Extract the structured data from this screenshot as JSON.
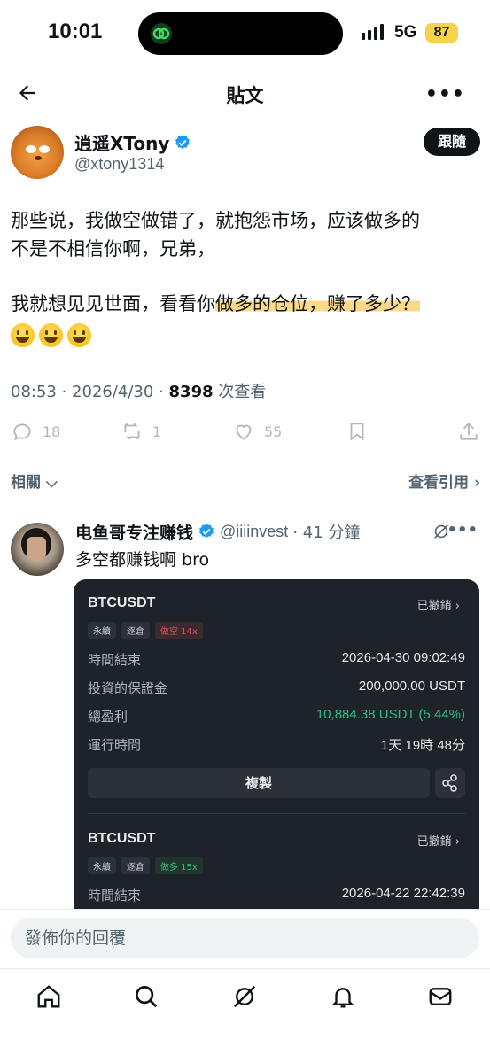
{
  "status_bar": {
    "time": "10:01",
    "network": "5G",
    "battery": "87"
  },
  "header": {
    "title": "貼文",
    "more": "•••"
  },
  "author": {
    "name": "逍遥XTony",
    "handle": "@xtony1314",
    "follow_label": "跟隨"
  },
  "tweet": {
    "line1": "那些说，我做空做错了，就抱怨市场，应该做多的",
    "line2": "不是不相信你啊，兄弟，",
    "line3_plain": "我就想见见世面，看看你",
    "line3_highlight": "做多的仓位，赚了多少？"
  },
  "meta": {
    "time": "08:53",
    "date": "2026/4/30",
    "views": "8398",
    "views_label": "次查看"
  },
  "actions": {
    "replies": "18",
    "reposts": "1",
    "likes": "55"
  },
  "related": {
    "left": "相關",
    "right": "查看引用"
  },
  "quote": {
    "name": "电鱼哥专注赚钱",
    "handle": "@iiiinvest",
    "time": "· 41 分鐘",
    "text": "多空都赚钱啊 bro"
  },
  "card": {
    "position1": {
      "symbol": "BTCUSDT",
      "status": "已撤銷",
      "tags": [
        "永續",
        "逐倉",
        "做空 14x"
      ],
      "rows": [
        {
          "k": "時間結束",
          "v": "2026-04-30 09:02:49"
        },
        {
          "k": "投資的保證金",
          "v": "200,000.00 USDT"
        },
        {
          "k": "總盈利",
          "v": "10,884.38 USDT (5.44%)"
        },
        {
          "k": "運行時間",
          "v": "1天 19時 48分"
        }
      ],
      "copy_label": "複製"
    },
    "position2": {
      "symbol": "BTCUSDT",
      "status": "已撤銷",
      "tags": [
        "永續",
        "逐倉",
        "做多 15x"
      ],
      "rows": [
        {
          "k": "時間結束",
          "v": "2026-04-22 22:42:39"
        }
      ]
    }
  },
  "reply": {
    "placeholder": "發佈你的回覆"
  },
  "icons": [
    "back-arrow-icon",
    "verified-icon",
    "reply-icon",
    "repost-icon",
    "like-icon",
    "bookmark-icon",
    "share-icon",
    "grok-icon",
    "home-icon",
    "search-icon",
    "notifications-icon",
    "messages-icon"
  ],
  "colors": {
    "accent": "#1d9bf0",
    "highlight": "#fbd98a",
    "profit": "#2fbd85",
    "short": "#e0535c"
  }
}
